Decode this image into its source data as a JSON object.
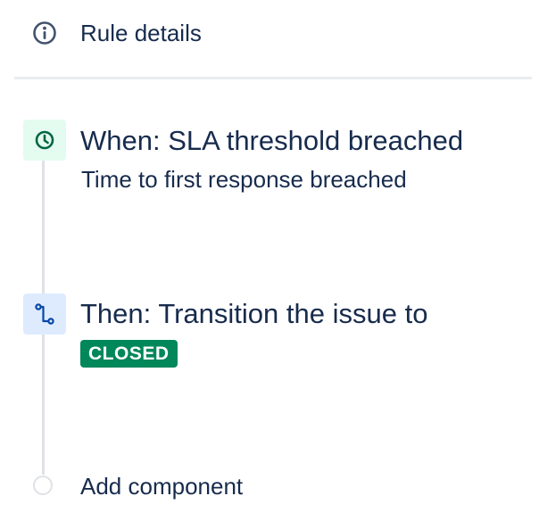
{
  "header": {
    "title": "Rule details",
    "icon": "info-icon"
  },
  "trigger": {
    "title": "When: SLA threshold breached",
    "description": "Time to first response breached",
    "icon": "clock-icon",
    "tile_color": "#e3fcef",
    "icon_color": "#006644"
  },
  "action": {
    "title": "Then: Transition the issue to",
    "status": "CLOSED",
    "status_color": "#00875a",
    "icon": "transition-icon",
    "tile_color": "#deebff",
    "icon_color": "#0747a6"
  },
  "add_component": {
    "label": "Add component",
    "icon": "empty-circle-icon"
  }
}
